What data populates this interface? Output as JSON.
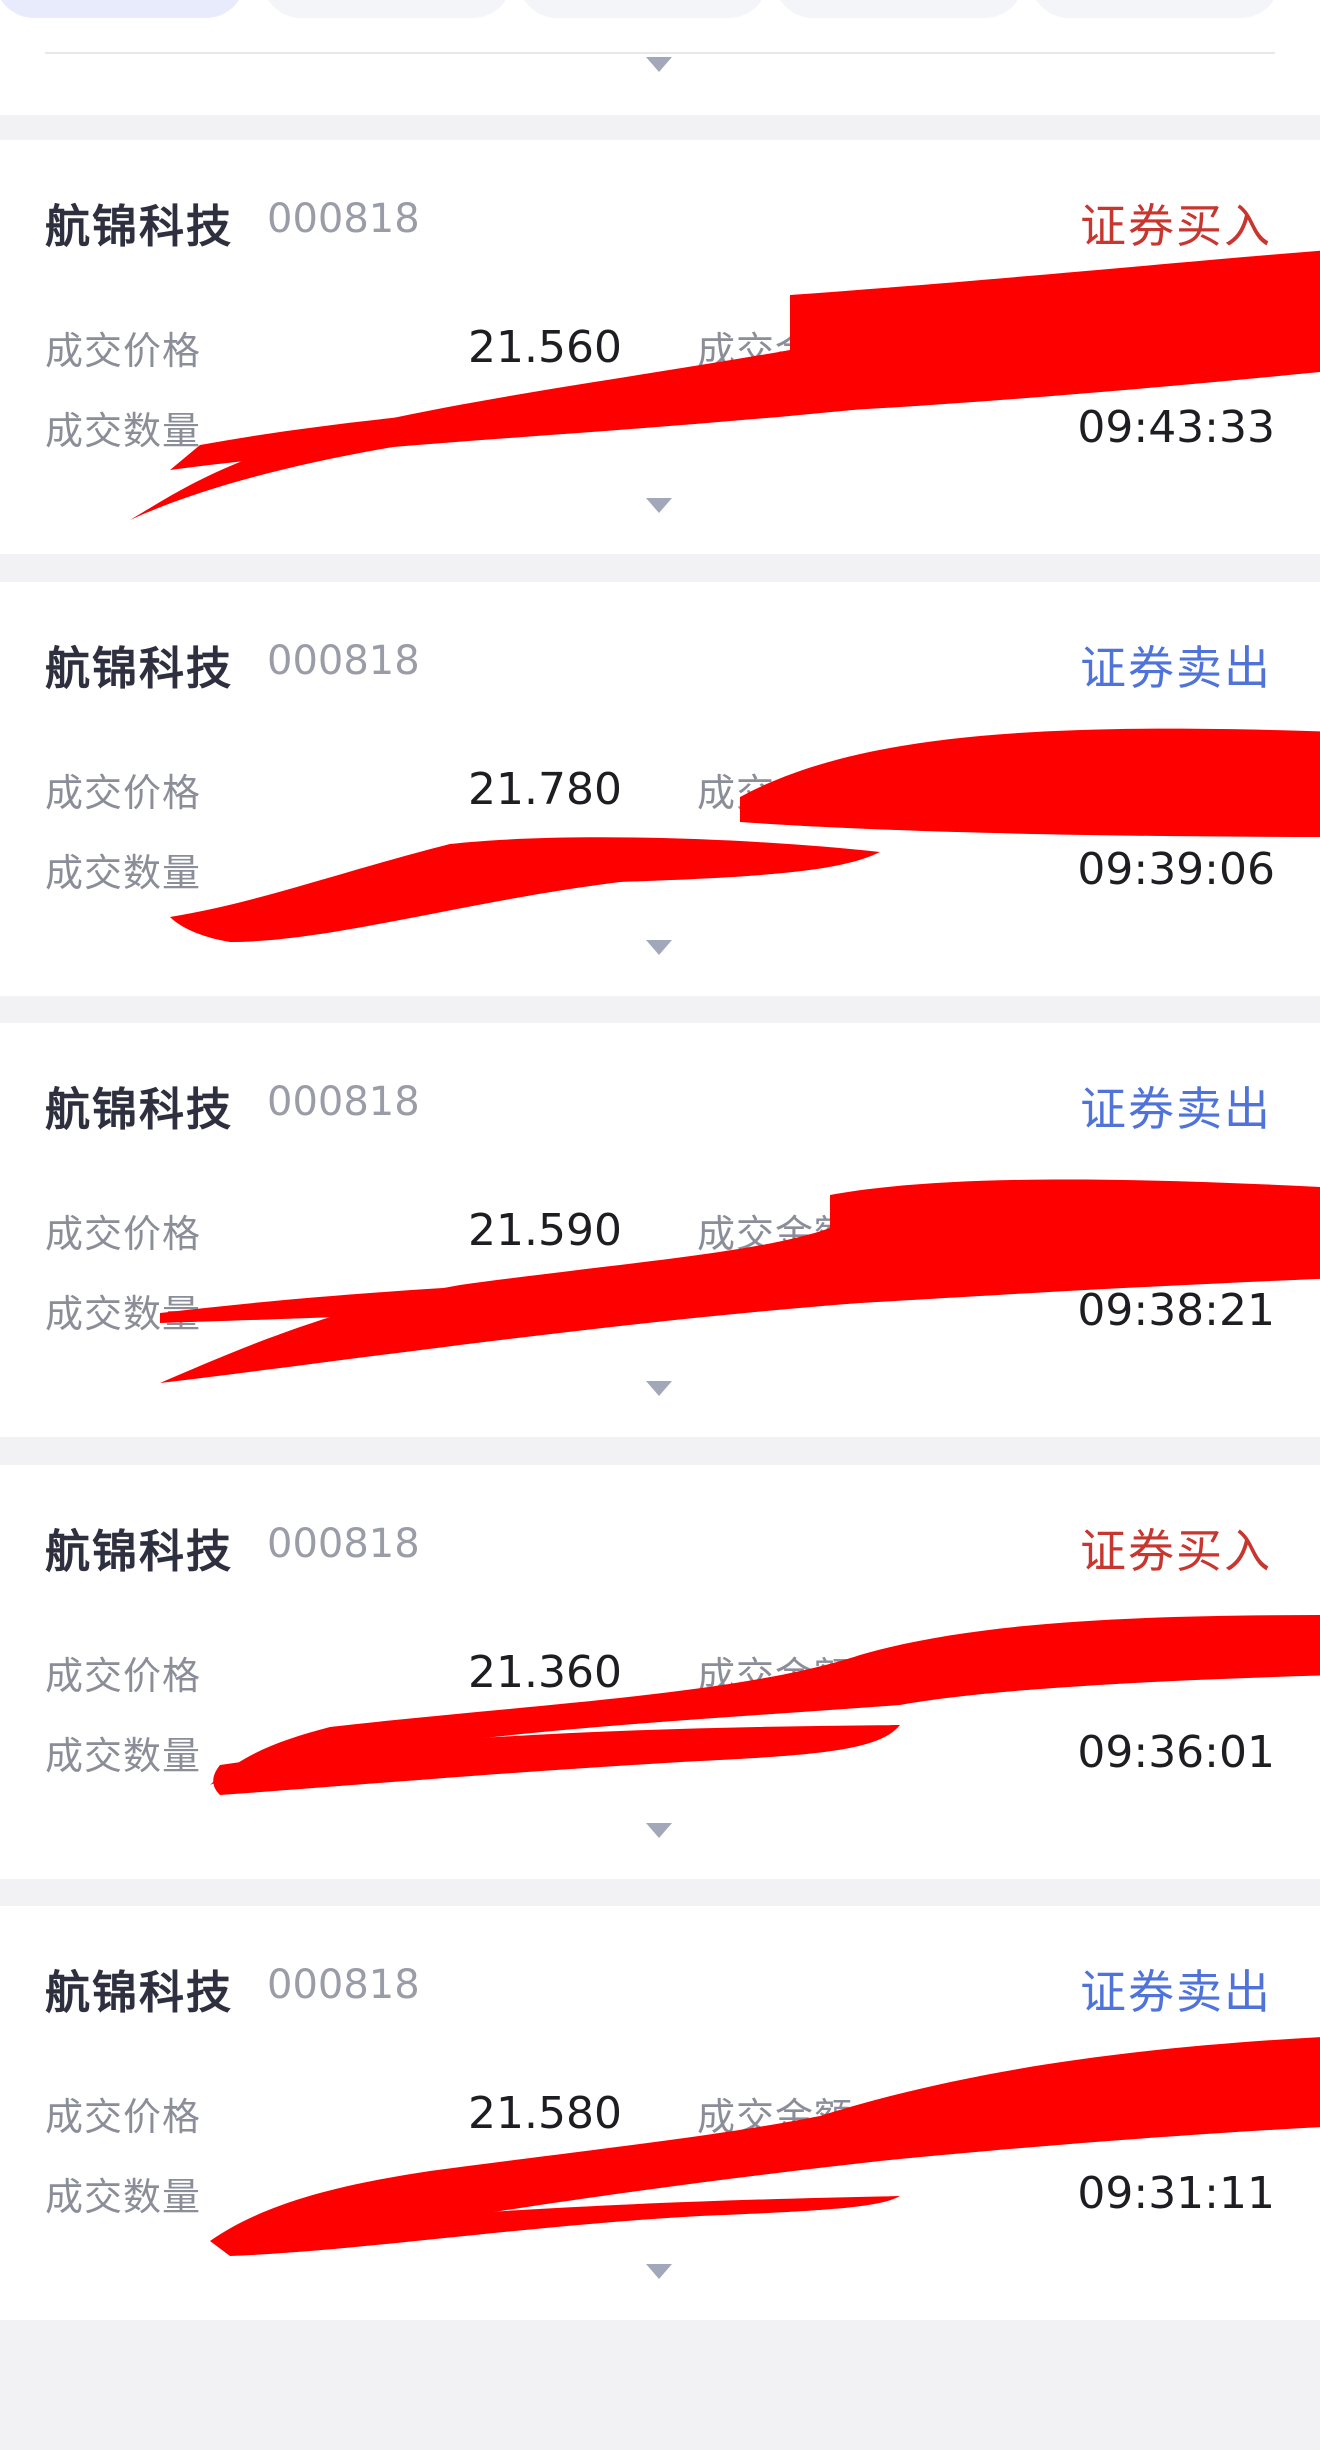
{
  "labels": {
    "price": "成交价格",
    "amount": "成交金额",
    "quantity": "成交数量"
  },
  "colors": {
    "buy": "#c7372f",
    "sell": "#4f73d9",
    "redaction": "#ff0000"
  },
  "trades": [
    {
      "name": "航锦科技",
      "code": "000818",
      "type": "证券买入",
      "side": "buy",
      "price": "21.560",
      "time": "09:43:33"
    },
    {
      "name": "航锦科技",
      "code": "000818",
      "type": "证券卖出",
      "side": "sell",
      "price": "21.780",
      "time": "09:39:06"
    },
    {
      "name": "航锦科技",
      "code": "000818",
      "type": "证券卖出",
      "side": "sell",
      "price": "21.590",
      "time": "09:38:21"
    },
    {
      "name": "航锦科技",
      "code": "000818",
      "type": "证券买入",
      "side": "buy",
      "price": "21.360",
      "time": "09:36:01"
    },
    {
      "name": "航锦科技",
      "code": "000818",
      "type": "证券卖出",
      "side": "sell",
      "price": "21.580",
      "time": "09:31:11"
    }
  ],
  "icons": {
    "expand": "caret-down-icon"
  }
}
